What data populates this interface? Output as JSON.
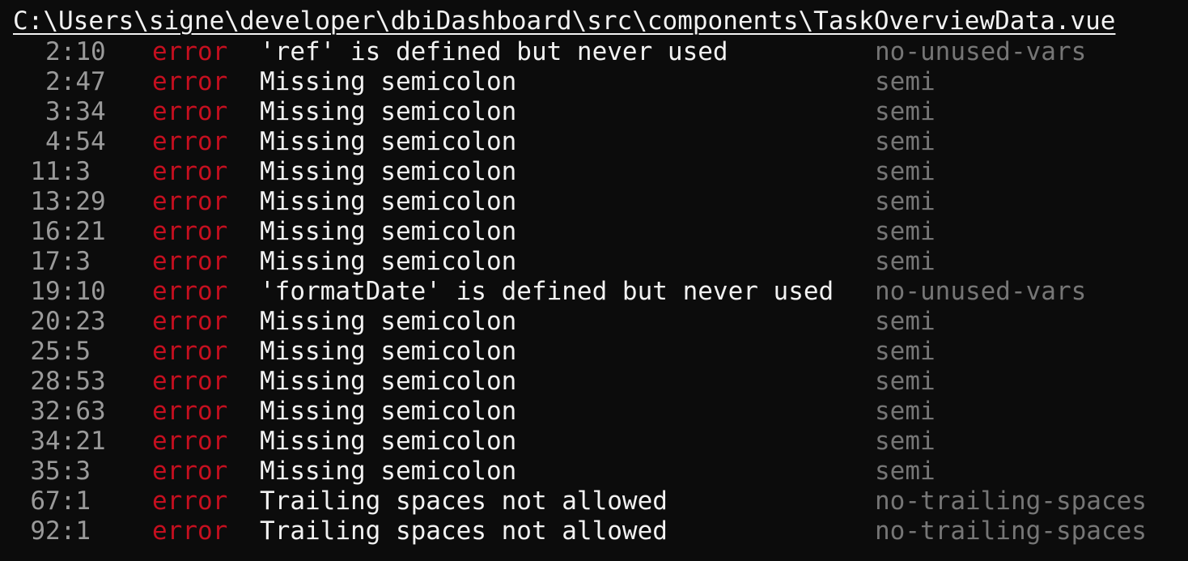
{
  "file_path": "C:\\Users\\signe\\developer\\dbiDashboard\\src\\components\\TaskOverviewData.vue",
  "colors": {
    "background": "#0c0c0c",
    "path": "#f2f2f2",
    "location": "#9a9a9a",
    "severity": "#c50f1f",
    "message": "#f2f2f2",
    "rule": "#767676"
  },
  "problems": [
    {
      "location": "2:10",
      "severity": "error",
      "message": "'ref' is defined but never used",
      "rule": "no-unused-vars"
    },
    {
      "location": "2:47",
      "severity": "error",
      "message": "Missing semicolon",
      "rule": "semi"
    },
    {
      "location": "3:34",
      "severity": "error",
      "message": "Missing semicolon",
      "rule": "semi"
    },
    {
      "location": "4:54",
      "severity": "error",
      "message": "Missing semicolon",
      "rule": "semi"
    },
    {
      "location": "11:3",
      "severity": "error",
      "message": "Missing semicolon",
      "rule": "semi"
    },
    {
      "location": "13:29",
      "severity": "error",
      "message": "Missing semicolon",
      "rule": "semi"
    },
    {
      "location": "16:21",
      "severity": "error",
      "message": "Missing semicolon",
      "rule": "semi"
    },
    {
      "location": "17:3",
      "severity": "error",
      "message": "Missing semicolon",
      "rule": "semi"
    },
    {
      "location": "19:10",
      "severity": "error",
      "message": "'formatDate' is defined but never used",
      "rule": "no-unused-vars"
    },
    {
      "location": "20:23",
      "severity": "error",
      "message": "Missing semicolon",
      "rule": "semi"
    },
    {
      "location": "25:5",
      "severity": "error",
      "message": "Missing semicolon",
      "rule": "semi"
    },
    {
      "location": "28:53",
      "severity": "error",
      "message": "Missing semicolon",
      "rule": "semi"
    },
    {
      "location": "32:63",
      "severity": "error",
      "message": "Missing semicolon",
      "rule": "semi"
    },
    {
      "location": "34:21",
      "severity": "error",
      "message": "Missing semicolon",
      "rule": "semi"
    },
    {
      "location": "35:3",
      "severity": "error",
      "message": "Missing semicolon",
      "rule": "semi"
    },
    {
      "location": "67:1",
      "severity": "error",
      "message": "Trailing spaces not allowed",
      "rule": "no-trailing-spaces"
    },
    {
      "location": "92:1",
      "severity": "error",
      "message": "Trailing spaces not allowed",
      "rule": "no-trailing-spaces"
    }
  ]
}
